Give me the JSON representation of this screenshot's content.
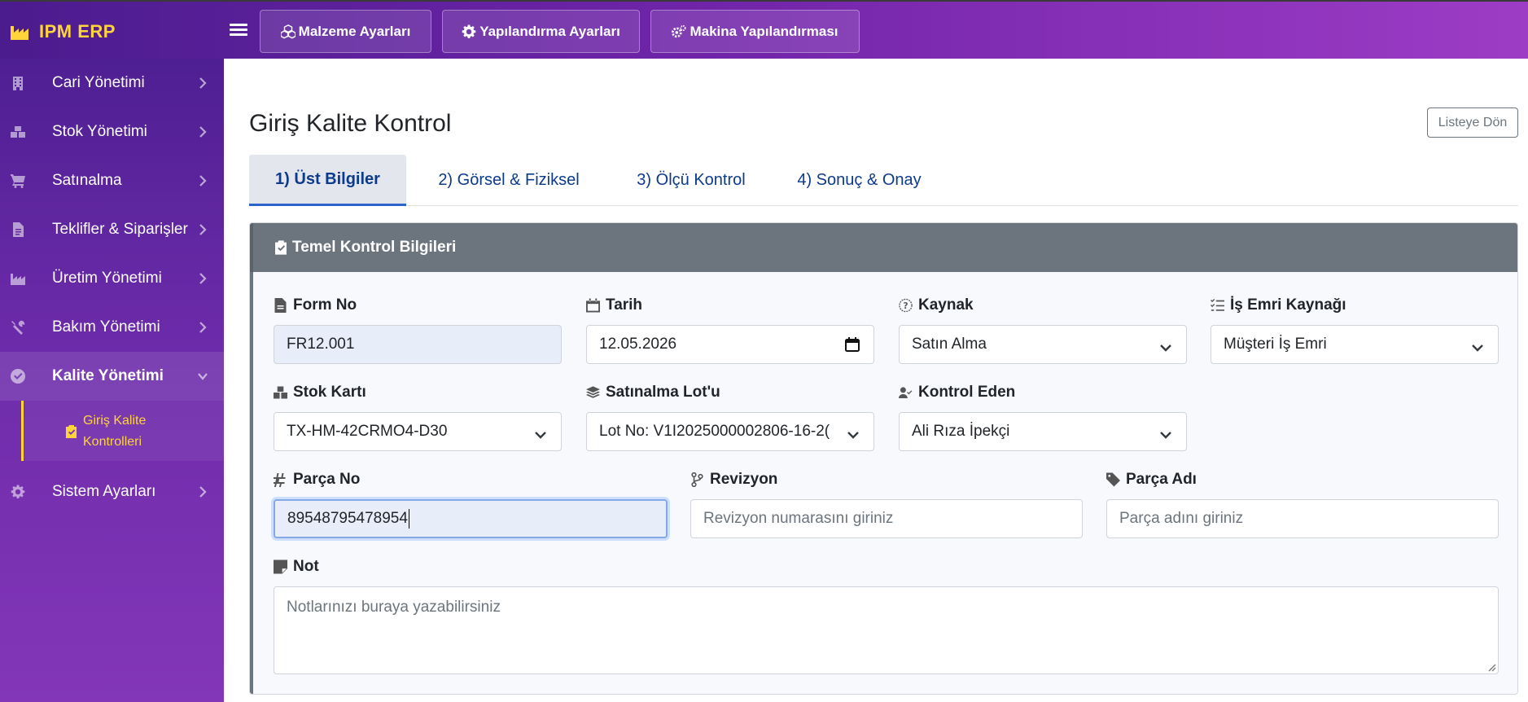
{
  "app": {
    "brand": "IPM ERP"
  },
  "topnav": {
    "buttons": [
      {
        "label": "Malzeme Ayarları",
        "icon": "cubes-icon"
      },
      {
        "label": "Yapılandırma Ayarları",
        "icon": "gear-icon"
      },
      {
        "label": "Makina Yapılandırması",
        "icon": "gears-icon"
      }
    ]
  },
  "sidebar": {
    "items": [
      {
        "label": "Cari Yönetimi",
        "icon": "building-icon"
      },
      {
        "label": "Stok Yönetimi",
        "icon": "boxes-icon"
      },
      {
        "label": "Satınalma",
        "icon": "cart-icon"
      },
      {
        "label": "Teklifler & Siparişler",
        "icon": "invoice-icon"
      },
      {
        "label": "Üretim Yönetimi",
        "icon": "industry-icon"
      },
      {
        "label": "Bakım Yönetimi",
        "icon": "tools-icon"
      },
      {
        "label": "Kalite Yönetimi",
        "icon": "check-circle-icon",
        "active": true
      },
      {
        "label": "Sistem Ayarları",
        "icon": "gear-icon"
      }
    ],
    "subitem": {
      "label": "Giriş Kalite Kontrolleri",
      "icon": "clipboard-check-icon"
    }
  },
  "page": {
    "title": "Giriş Kalite Kontrol",
    "back_button": "Listeye Dön"
  },
  "tabs": [
    {
      "label": "1) Üst Bilgiler",
      "active": true
    },
    {
      "label": "2) Görsel & Fiziksel"
    },
    {
      "label": "3) Ölçü Kontrol"
    },
    {
      "label": "4) Sonuç & Onay"
    }
  ],
  "card": {
    "title": "Temel Kontrol Bilgileri",
    "fields": {
      "form_no": {
        "label": "Form No",
        "value": "FR12.001"
      },
      "tarih": {
        "label": "Tarih",
        "value": "12.05.2026"
      },
      "kaynak": {
        "label": "Kaynak",
        "value": "Satın Alma"
      },
      "is_emri_kaynagi": {
        "label": "İş Emri Kaynağı",
        "value": "Müşteri İş Emri"
      },
      "stok_karti": {
        "label": "Stok Kartı",
        "value": "TX-HM-42CRMO4-D30"
      },
      "satinalma_lotu": {
        "label": "Satınalma Lot'u",
        "value": "Lot No: V1I2025000002806-16-2("
      },
      "kontrol_eden": {
        "label": "Kontrol Eden",
        "value": "Ali Rıza İpekçi"
      },
      "parca_no": {
        "label": "Parça No",
        "value": "89548795478954"
      },
      "revizyon": {
        "label": "Revizyon",
        "placeholder": "Revizyon numarasını giriniz"
      },
      "parca_adi": {
        "label": "Parça Adı",
        "placeholder": "Parça adını giriniz"
      },
      "not": {
        "label": "Not",
        "placeholder": "Notlarınızı buraya yazabilirsiniz"
      }
    }
  }
}
